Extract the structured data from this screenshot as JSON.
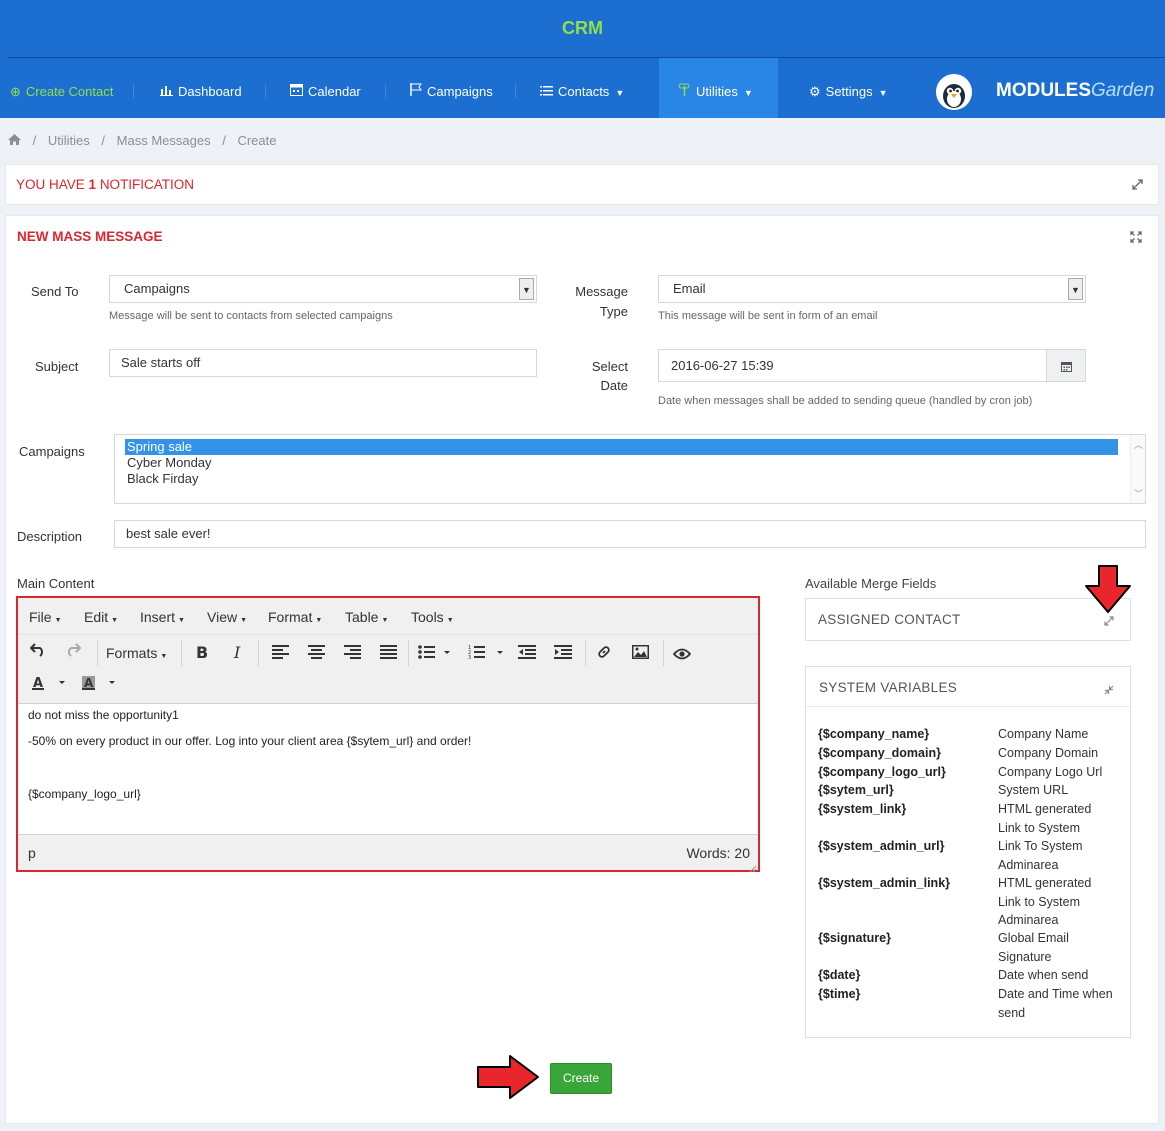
{
  "header": {
    "brand": "CRM",
    "logo_main": "MODULES",
    "logo_sub": "Garden"
  },
  "nav": {
    "create_contact": "Create Contact",
    "dashboard": "Dashboard",
    "calendar": "Calendar",
    "campaigns": "Campaigns",
    "contacts": "Contacts",
    "utilities": "Utilities",
    "settings": "Settings"
  },
  "breadcrumb": [
    "Utilities",
    "Mass Messages",
    "Create"
  ],
  "notification": {
    "prefix": "YOU HAVE",
    "count": "1",
    "suffix": "NOTIFICATION"
  },
  "form": {
    "title": "NEW MASS MESSAGE",
    "send_to_label": "Send To",
    "send_to_value": "Campaigns",
    "send_to_help": "Message will be sent to contacts from selected campaigns",
    "message_type_label_1": "Message",
    "message_type_label_2": "Type",
    "message_type_value": "Email",
    "message_type_help": "This message will be sent in form of an email",
    "subject_label": "Subject",
    "subject_value": "Sale starts off",
    "select_date_label_1": "Select",
    "select_date_label_2": "Date",
    "select_date_value": "2016-06-27 15:39",
    "select_date_help": "Date when messages shall be added to sending queue (handled by cron job)",
    "campaigns_label": "Campaigns",
    "campaigns_options": [
      "Spring sale",
      "Cyber Monday",
      "Black Firday"
    ],
    "campaigns_selected": "Spring sale",
    "description_label": "Description",
    "description_value": "best sale ever!",
    "main_content_label": "Main Content",
    "create_button": "Create"
  },
  "editor": {
    "menus": [
      "File",
      "Edit",
      "Insert",
      "View",
      "Format",
      "Table",
      "Tools"
    ],
    "formats_label": "Formats",
    "content": [
      "do not miss the opportunity1",
      "-50% on every product in our offer. Log into your client area {$sytem_url} and order!",
      "{$company_logo_url}"
    ],
    "path": "p",
    "word_count": "Words: 20"
  },
  "merge": {
    "title": "Available Merge Fields",
    "assigned_contact": "ASSIGNED CONTACT",
    "system_variables": "SYSTEM VARIABLES",
    "items": [
      {
        "key": "{$company_name}",
        "desc": "Company Name"
      },
      {
        "key": "{$company_domain}",
        "desc": "Company Domain"
      },
      {
        "key": "{$company_logo_url}",
        "desc": "Company Logo Url"
      },
      {
        "key": "{$sytem_url}",
        "desc": "System URL"
      },
      {
        "key": "{$system_link}",
        "desc": "HTML generated Link to System"
      },
      {
        "key": "{$system_admin_url}",
        "desc": "Link To System Adminarea"
      },
      {
        "key": "{$system_admin_link}",
        "desc": "HTML generated Link to System Adminarea"
      },
      {
        "key": "{$signature}",
        "desc": "Global Email Signature"
      },
      {
        "key": "{$date}",
        "desc": "Date when send"
      },
      {
        "key": "{$time}",
        "desc": "Date and Time when send"
      }
    ]
  },
  "colors": {
    "header_bg": "#1c6fd0",
    "accent_green": "#8fe04a",
    "title_red": "#d9272e",
    "button_green": "#3aa63a"
  }
}
